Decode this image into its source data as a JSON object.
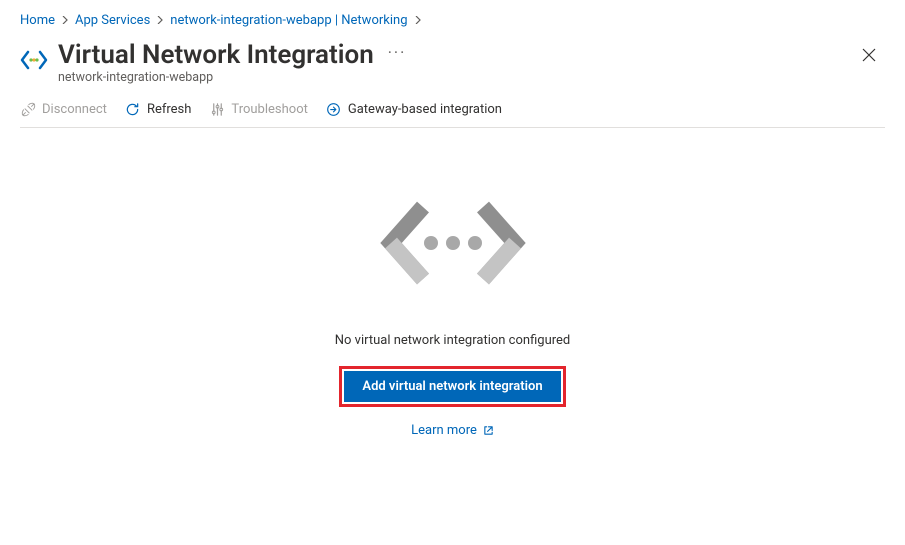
{
  "breadcrumb": {
    "items": [
      "Home",
      "App Services",
      "network-integration-webapp | Networking"
    ]
  },
  "header": {
    "title": "Virtual Network Integration",
    "subtitle": "network-integration-webapp"
  },
  "toolbar": {
    "disconnect": "Disconnect",
    "refresh": "Refresh",
    "troubleshoot": "Troubleshoot",
    "gateway": "Gateway-based integration"
  },
  "empty": {
    "message": "No virtual network integration configured",
    "add_button": "Add virtual network integration",
    "learn_more": "Learn more"
  },
  "colors": {
    "link": "#0067b8",
    "primary_button": "#0067b8",
    "highlight_border": "#e3252d"
  }
}
